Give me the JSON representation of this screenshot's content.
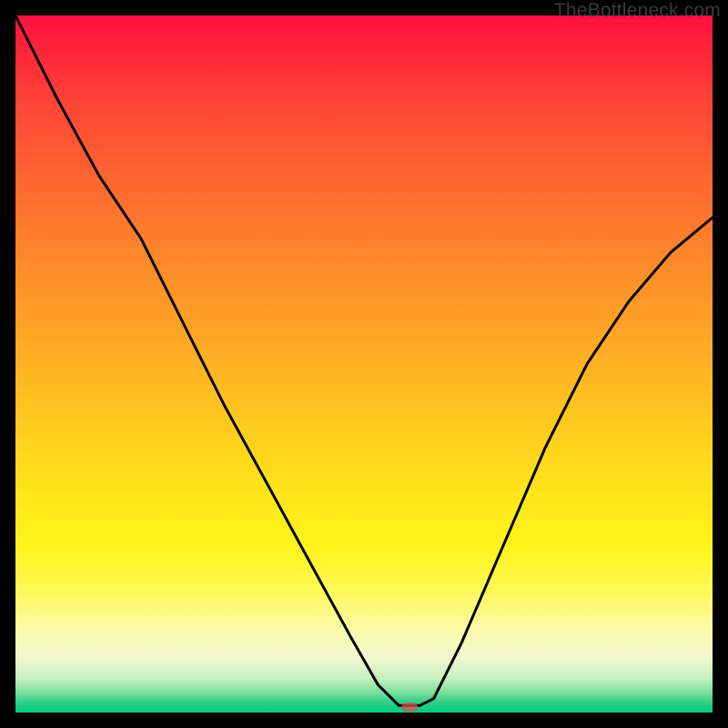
{
  "watermark": "TheBottleneck.com",
  "chart_data": {
    "type": "line",
    "title": "",
    "xlabel": "",
    "ylabel": "",
    "xlim": [
      0,
      100
    ],
    "ylim": [
      0,
      100
    ],
    "grid": false,
    "series": [
      {
        "name": "bottleneck-curve",
        "x": [
          0,
          6,
          12,
          18,
          24,
          30,
          36,
          42,
          48,
          52,
          55,
          58,
          60,
          64,
          70,
          76,
          82,
          88,
          94,
          100
        ],
        "values": [
          100,
          88,
          77,
          68,
          56,
          44,
          33,
          22,
          11,
          4,
          1,
          1,
          2,
          10,
          24,
          38,
          50,
          59,
          66,
          71
        ]
      }
    ],
    "marker": {
      "x": 56.5,
      "y": 0.8
    },
    "background_gradient": {
      "top": "#ff1040",
      "mid": "#ffe61a",
      "bottom": "#00cc78"
    }
  }
}
